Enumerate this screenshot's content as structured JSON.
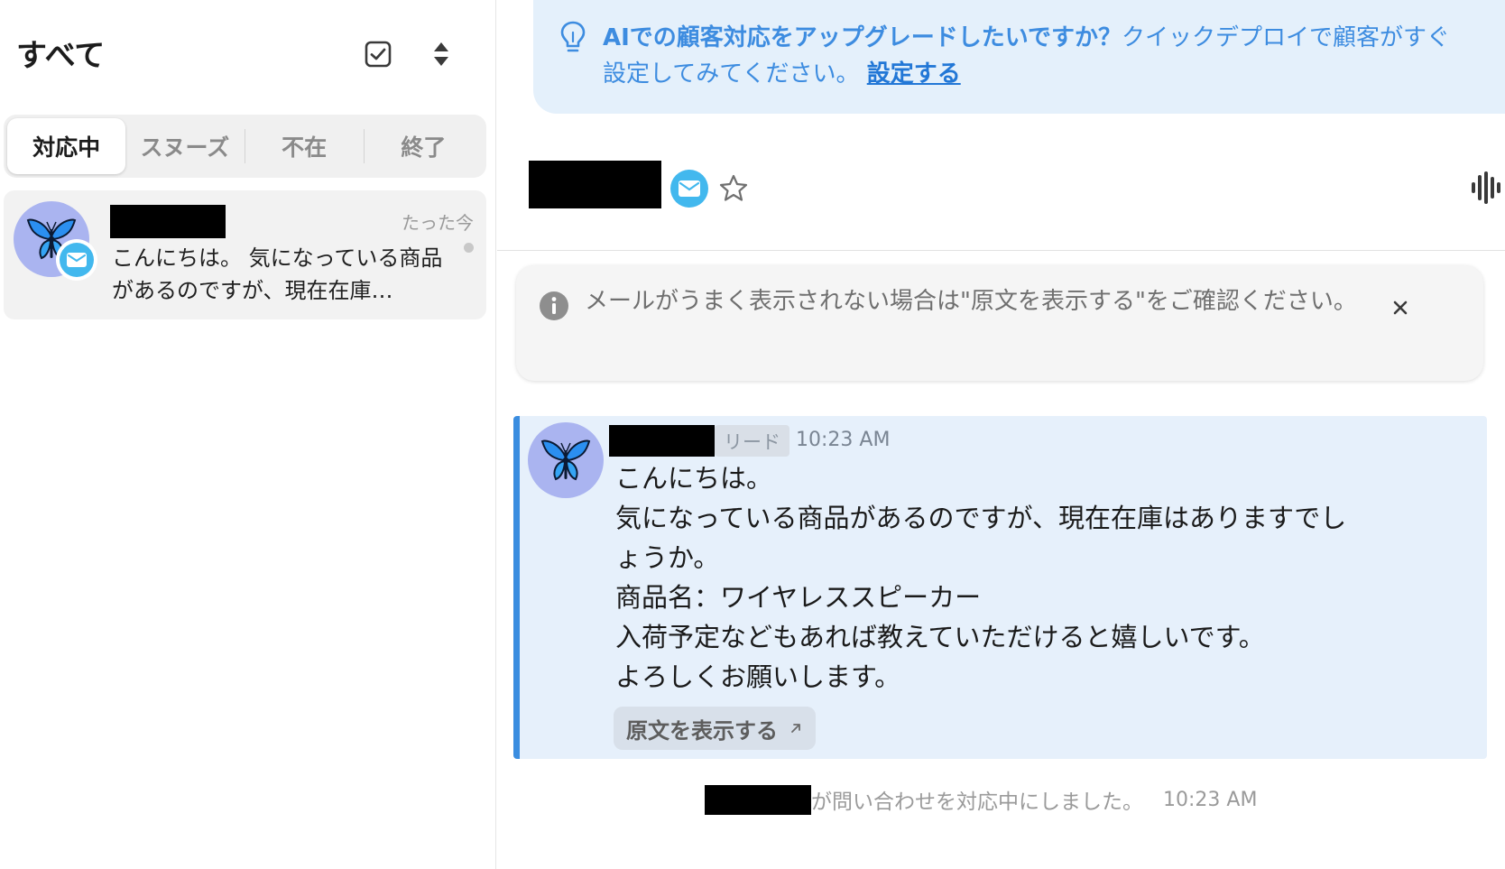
{
  "sidebar": {
    "title": "すべて",
    "tabs": [
      {
        "label": "対応中",
        "active": true
      },
      {
        "label": "スヌーズ",
        "active": false
      },
      {
        "label": "不在",
        "active": false
      },
      {
        "label": "終了",
        "active": false
      }
    ],
    "conversation": {
      "time": "たった今",
      "preview": "こんにちは。 気になっている商品があるのですが、現在在庫…",
      "avatar_icon": "butterfly-icon",
      "channel_icon": "mail-icon"
    }
  },
  "banner": {
    "bold_text": "AIでの顧客対応をアップグレードしたいですか？",
    "text_line1": "クイックデプロイで顧客がすぐ",
    "text_line2": "設定してみてください。",
    "link_text": "設定する"
  },
  "conversation_header": {
    "channel_icon": "mail-icon",
    "star_icon": "star-icon",
    "voice_icon": "waveform-icon"
  },
  "notice": {
    "text": "メールがうまく表示されない場合は\"原文を表示する\"をご確認ください。",
    "close_label": "×"
  },
  "message": {
    "badge": "リード",
    "time": "10:23 AM",
    "lines": [
      "こんにちは。",
      "気になっている商品があるのですが、現在在庫はありますでし",
      "ょうか。",
      "商品名：ワイヤレススピーカー",
      "入荷予定などもあれば教えていただけると嬉しいです。",
      "よろしくお願いします。"
    ],
    "raw_button": "原文を表示する"
  },
  "event": {
    "text": "が問い合わせを対応中にしました。",
    "time": "10:23 AM"
  },
  "colors": {
    "accent": "#3a8de0",
    "banner_bg": "#e4f0fb",
    "mail": "#42b8ee",
    "avatar_bg": "#aab4f0"
  }
}
